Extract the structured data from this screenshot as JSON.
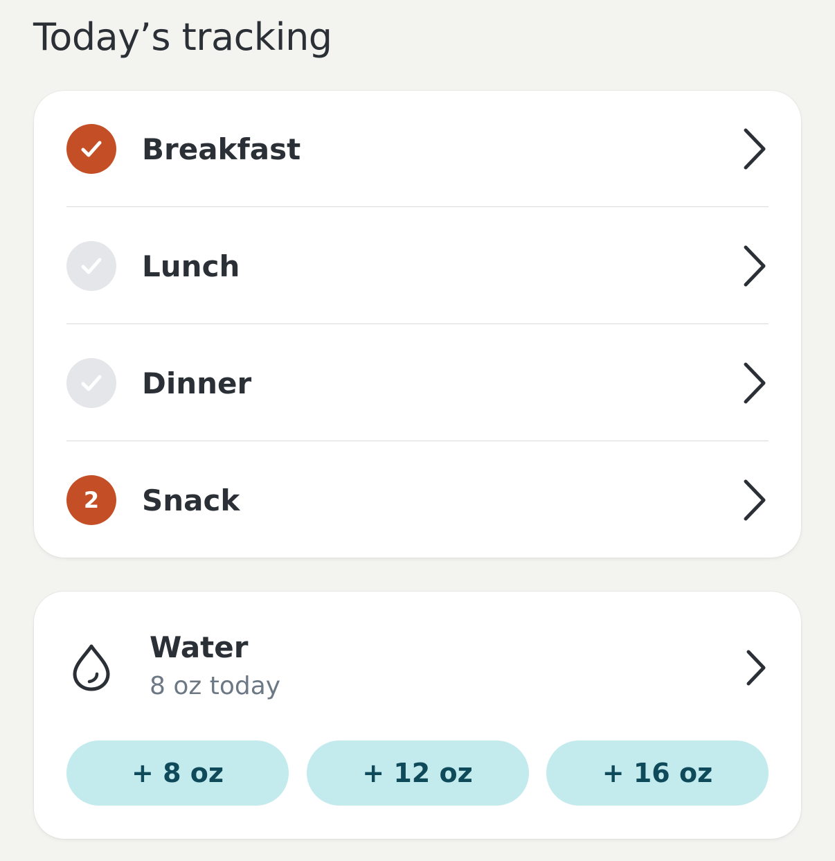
{
  "page": {
    "title": "Today’s tracking"
  },
  "meals": [
    {
      "label": "Breakfast",
      "status": "done",
      "icon": "check-icon"
    },
    {
      "label": "Lunch",
      "status": "todo",
      "icon": "check-icon"
    },
    {
      "label": "Dinner",
      "status": "todo",
      "icon": "check-icon"
    },
    {
      "label": "Snack",
      "status": "count",
      "count": "2"
    }
  ],
  "water": {
    "title": "Water",
    "subtitle": "8 oz today",
    "icon": "water-drop-icon",
    "buttons": [
      "+ 8 oz",
      "+ 12 oz",
      "+ 16 oz"
    ]
  },
  "colors": {
    "accent": "#c44f27",
    "inactive_check": "#e4e6e9",
    "water_button_bg": "#c3ebee",
    "water_button_text": "#0e4a59",
    "background": "#f3f3ef"
  }
}
